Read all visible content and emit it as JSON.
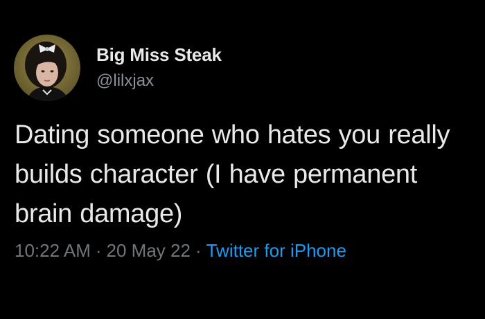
{
  "author": {
    "display_name": "Big Miss Steak",
    "handle": "@lilxjax",
    "avatar_icon": "profile-photo"
  },
  "tweet": {
    "text": "Dating someone who hates you really builds character (I have permanent brain damage)"
  },
  "meta": {
    "time": "10:22 AM",
    "date": "20 May 22",
    "source": "Twitter for iPhone",
    "separator": "·"
  },
  "colors": {
    "background": "#000000",
    "text_primary": "#e7e9ea",
    "text_secondary": "#71767b",
    "link": "#1d9bf0"
  }
}
